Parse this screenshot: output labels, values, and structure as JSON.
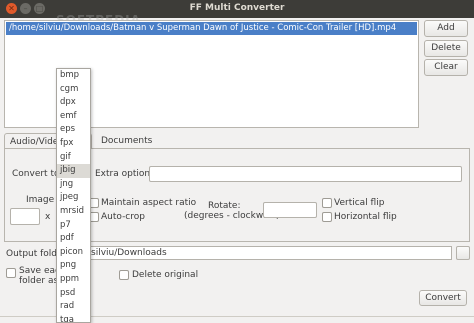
{
  "window": {
    "title": "FF Multi Converter",
    "controls": [
      "close-icon",
      "minimize-icon",
      "maximize-icon"
    ]
  },
  "watermark": "SOFTPEDIA",
  "file_list": {
    "items": [
      "/home/silviu/Downloads/Batman v Superman Dawn of Justice - Comic-Con Trailer [HD].mp4"
    ]
  },
  "side_buttons": {
    "add": "Add",
    "delete": "Delete",
    "clear": "Clear"
  },
  "tabs": {
    "audio_video": "Audio/Video",
    "documents": "Documents"
  },
  "image_panel": {
    "convert_to_label": "Convert to:",
    "extra_options_label": "Extra options:",
    "extra_options_value": "",
    "image_size_label": "Image S",
    "size_x_label": "x",
    "maintain_aspect": "Maintain aspect ratio",
    "auto_crop": "Auto-crop",
    "rotate_label": "Rotate:",
    "rotate_hint": "(degrees - clockwise)",
    "vertical_flip": "Vertical flip",
    "horizontal_flip": "Horizontal flip"
  },
  "output": {
    "label": "Output folder",
    "value": "silviu/Downloads",
    "save_each_line1": "Save each",
    "save_each_line2": "folder as i",
    "delete_original": "Delete original"
  },
  "convert_button": "Convert",
  "format_dropdown": {
    "selected": "jbig",
    "options": [
      "bmp",
      "cgm",
      "dpx",
      "emf",
      "eps",
      "fpx",
      "gif",
      "jbig",
      "jng",
      "jpeg",
      "mrsid",
      "p7",
      "pdf",
      "picon",
      "png",
      "ppm",
      "psd",
      "rad",
      "tga"
    ]
  },
  "colors": {
    "selection": "#4a7fc7",
    "titlebar": "#3d3c38",
    "close": "#e05a2b"
  }
}
